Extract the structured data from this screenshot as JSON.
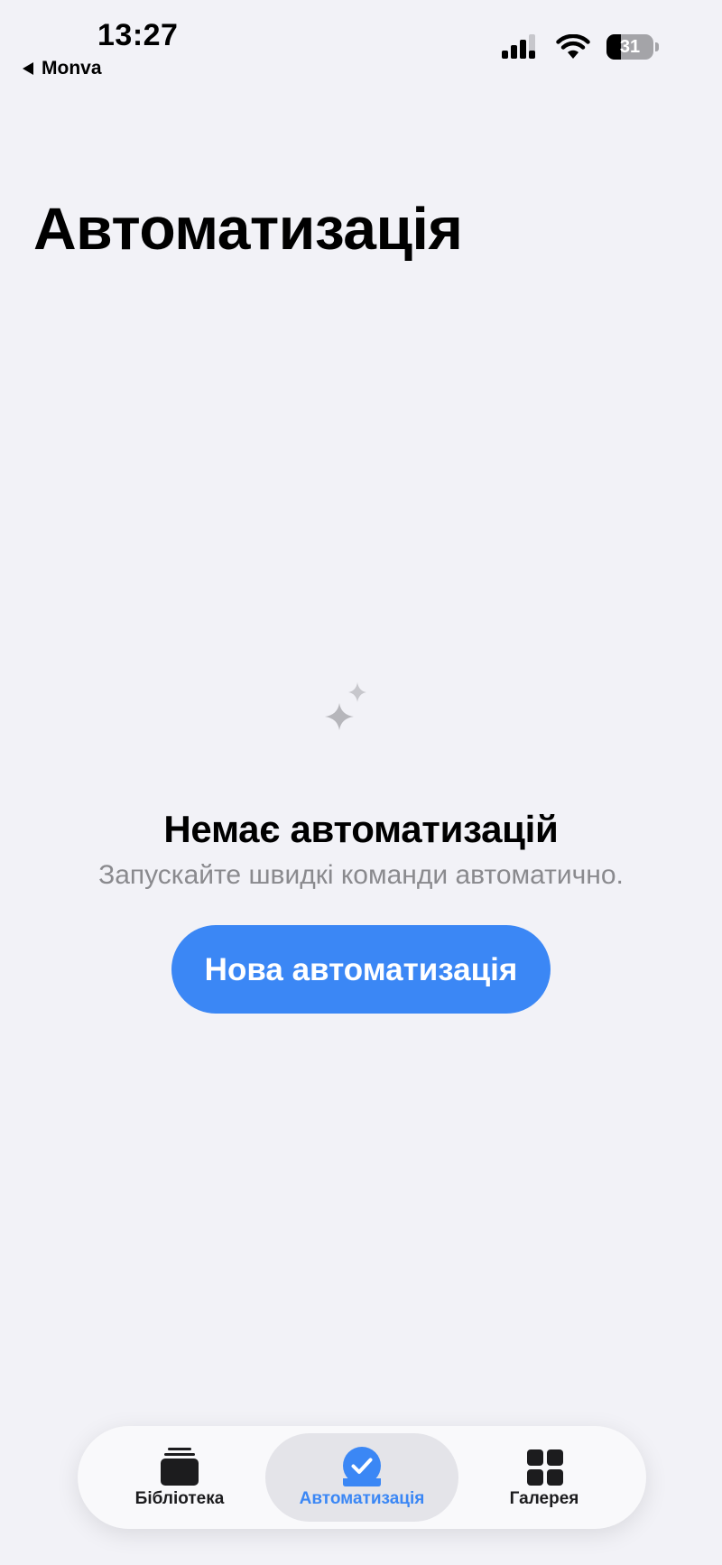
{
  "status_bar": {
    "time": "13:27",
    "back_label": "Monva",
    "battery_level": "31",
    "battery_fraction": 0.31
  },
  "header": {
    "title": "Автоматизація"
  },
  "empty_state": {
    "icon": "sparkles-icon",
    "title": "Немає автоматизацій",
    "subtitle": "Запускайте швидкі команди автоматично.",
    "button_label": "Нова автоматизація"
  },
  "tab_bar": {
    "tabs": [
      {
        "label": "Бібліотека",
        "icon": "library-stack-icon",
        "selected": false
      },
      {
        "label": "Автоматизація",
        "icon": "automation-check-icon",
        "selected": true
      },
      {
        "label": "Галерея",
        "icon": "gallery-grid-icon",
        "selected": false
      }
    ]
  },
  "colors": {
    "background": "#f2f2f7",
    "accent": "#3b87f5",
    "secondary_text": "#8a8a8e",
    "sparkle_gray": "#8e8e93"
  }
}
